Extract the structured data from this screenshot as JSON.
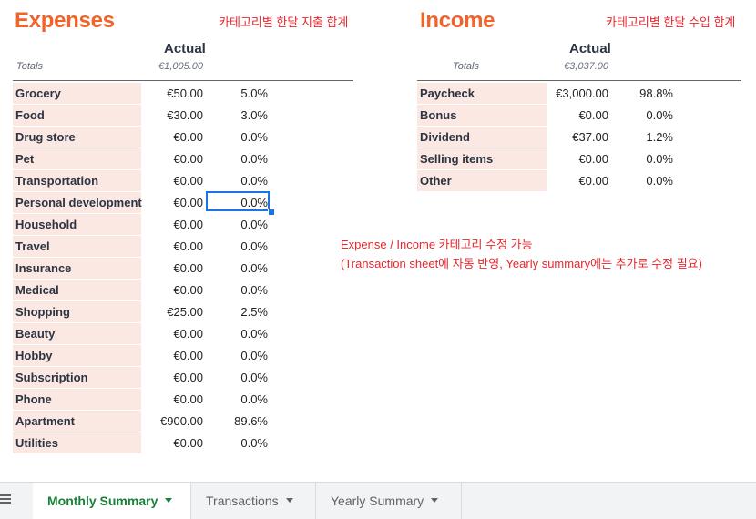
{
  "expenses": {
    "title": "Expenses",
    "note": "카테고리별 한달 지출 합계",
    "actual_header": "Actual",
    "totals_label": "Totals",
    "totals_value": "€1,005.00",
    "rows": [
      {
        "category": "Grocery",
        "amount": "€50.00",
        "pct": "5.0%"
      },
      {
        "category": "Food",
        "amount": "€30.00",
        "pct": "3.0%"
      },
      {
        "category": "Drug store",
        "amount": "€0.00",
        "pct": "0.0%"
      },
      {
        "category": "Pet",
        "amount": "€0.00",
        "pct": "0.0%"
      },
      {
        "category": "Transportation",
        "amount": "€0.00",
        "pct": "0.0%"
      },
      {
        "category": "Personal development",
        "amount": "€0.00",
        "pct": "0.0%"
      },
      {
        "category": "Household",
        "amount": "€0.00",
        "pct": "0.0%"
      },
      {
        "category": "Travel",
        "amount": "€0.00",
        "pct": "0.0%"
      },
      {
        "category": "Insurance",
        "amount": "€0.00",
        "pct": "0.0%"
      },
      {
        "category": "Medical",
        "amount": "€0.00",
        "pct": "0.0%"
      },
      {
        "category": "Shopping",
        "amount": "€25.00",
        "pct": "2.5%"
      },
      {
        "category": "Beauty",
        "amount": "€0.00",
        "pct": "0.0%"
      },
      {
        "category": "Hobby",
        "amount": "€0.00",
        "pct": "0.0%"
      },
      {
        "category": "Subscription",
        "amount": "€0.00",
        "pct": "0.0%"
      },
      {
        "category": "Phone",
        "amount": "€0.00",
        "pct": "0.0%"
      },
      {
        "category": "Apartment",
        "amount": "€900.00",
        "pct": "89.6%"
      },
      {
        "category": "Utilities",
        "amount": "€0.00",
        "pct": "0.0%"
      }
    ]
  },
  "income": {
    "title": "Income",
    "note": "카테고리별 한달 수입 합계",
    "actual_header": "Actual",
    "totals_label": "Totals",
    "totals_value": "€3,037.00",
    "rows": [
      {
        "category": "Paycheck",
        "amount": "€3,000.00",
        "pct": "98.8%"
      },
      {
        "category": "Bonus",
        "amount": "€0.00",
        "pct": "0.0%"
      },
      {
        "category": "Dividend",
        "amount": "€37.00",
        "pct": "1.2%"
      },
      {
        "category": "Selling items",
        "amount": "€0.00",
        "pct": "0.0%"
      },
      {
        "category": "Other",
        "amount": "€0.00",
        "pct": "0.0%"
      }
    ]
  },
  "edit_note": {
    "line1": "Expense / Income 카테고리 수정 가능",
    "line2": "(Transaction sheet에 자동 반영, Yearly summary에는 추가로 수정 필요)"
  },
  "tabs": [
    {
      "label": "Monthly Summary",
      "active": true
    },
    {
      "label": "Transactions",
      "active": false
    },
    {
      "label": "Yearly Summary",
      "active": false
    }
  ],
  "colors": {
    "title": "#f0642a",
    "note": "#e8262b",
    "category_fill": "#fce8e2",
    "active_tab": "#188038",
    "selection": "#1a73e8"
  },
  "icons": {
    "all_sheets": "menu-icon",
    "tab_dropdown": "caret-down-icon"
  }
}
